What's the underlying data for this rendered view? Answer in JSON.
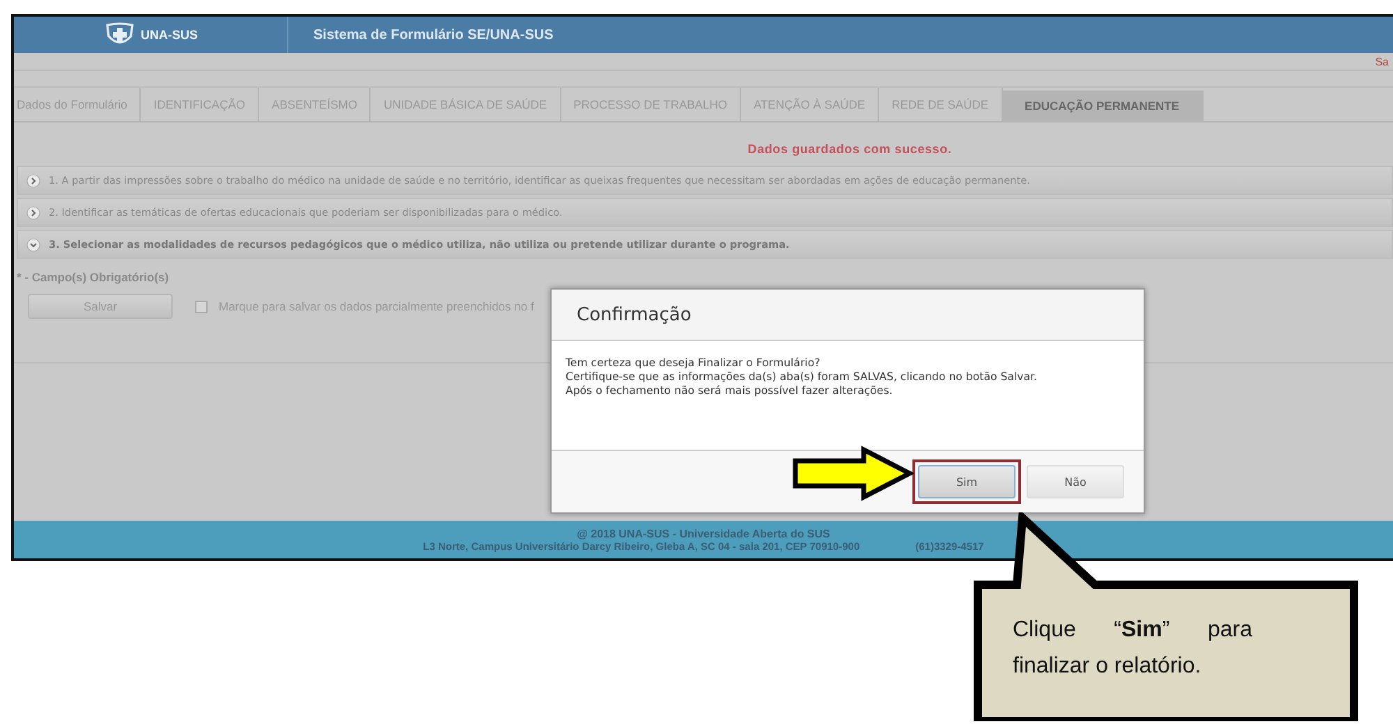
{
  "header": {
    "logo_text": "UNA-SUS",
    "title": "Sistema de Formulário SE/UNA-SUS"
  },
  "top_link": "Sa",
  "tabs": [
    {
      "label": "Dados do Formulário",
      "selected": false
    },
    {
      "label": "IDENTIFICAÇÃO",
      "selected": false
    },
    {
      "label": "ABSENTEÍSMO",
      "selected": false
    },
    {
      "label": "UNIDADE BÁSICA DE SAÚDE",
      "selected": false
    },
    {
      "label": "PROCESSO DE TRABALHO",
      "selected": false
    },
    {
      "label": "ATENÇÃO À SAÚDE",
      "selected": false
    },
    {
      "label": "REDE DE SAÚDE",
      "selected": false
    },
    {
      "label": "EDUCAÇÃO PERMANENTE",
      "selected": true
    }
  ],
  "status_message": "Dados guardados com sucesso.",
  "sections": [
    {
      "text": "1. A partir das impressões sobre o trabalho do médico na unidade de saúde e no território, identificar as queixas frequentes que necessitam ser abordadas em ações de educação permanente.",
      "expanded": false
    },
    {
      "text": "2. Identificar as temáticas de ofertas educacionais que poderiam ser disponibilizadas para o médico.",
      "expanded": false
    },
    {
      "text": "3. Selecionar as modalidades de recursos pedagógicos que o médico utiliza, não utiliza ou pretende utilizar durante o programa.",
      "expanded": true
    }
  ],
  "required_note": "* - Campo(s) Obrigatório(s)",
  "save_button": "Salvar",
  "partial_save": {
    "label": "Marque para salvar os dados parcialmente preenchidos no f",
    "checked": false
  },
  "dialog": {
    "title": "Confirmação",
    "lines": [
      "Tem certeza que deseja Finalizar o Formulário?",
      "Certifique-se que as informações da(s) aba(s) foram SALVAS, clicando no botão Salvar.",
      "Após o fechamento não será mais possível fazer alterações."
    ],
    "buttons": [
      {
        "label": "Sim",
        "highlighted": true
      },
      {
        "label": "Não",
        "highlighted": false
      }
    ]
  },
  "footer": {
    "copyright": "@ 2018 UNA-SUS - Universidade Aberta do SUS",
    "address": "L3 Norte, Campus Universitário Darcy Ribeiro, Gleba A, SC 04 - sala 201, CEP 70910-900",
    "phone": "(61)3329-4517"
  },
  "callout": {
    "text": "Clique “**Sim**” para finalizar o relatório."
  }
}
